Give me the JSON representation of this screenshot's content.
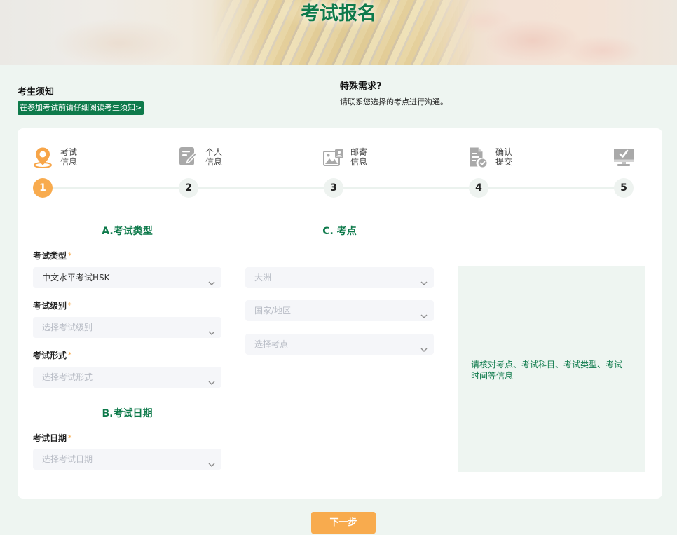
{
  "header": {
    "title": "考试报名"
  },
  "notice": {
    "candidate_title": "考生须知",
    "candidate_link": "在参加考试前请仔细阅读考生须知>",
    "special_title": "特殊需求?",
    "special_text": "请联系您选择的考点进行沟通。"
  },
  "steps": {
    "current": 1,
    "items": [
      {
        "number": "1",
        "label_lines": [
          "考试",
          "信息"
        ],
        "icon": "location-pin-icon"
      },
      {
        "number": "2",
        "label_lines": [
          "个人",
          "信息"
        ],
        "icon": "edit-document-icon"
      },
      {
        "number": "3",
        "label_lines": [
          "邮寄",
          "信息"
        ],
        "icon": "image-icon"
      },
      {
        "number": "4",
        "label_lines": [
          "确认",
          "提交"
        ],
        "icon": "document-check-icon"
      },
      {
        "number": "5",
        "icon": "monitor-check-icon"
      }
    ]
  },
  "form": {
    "required_mark": "*",
    "section_a": {
      "title": "A.考试类型",
      "fields": [
        {
          "label": "考试类型",
          "value": "中文水平考试HSK"
        },
        {
          "label": "考试级别",
          "placeholder": "选择考试级别"
        },
        {
          "label": "考试形式",
          "placeholder": "选择考试形式"
        }
      ]
    },
    "section_b": {
      "title": "B.考试日期",
      "fields": [
        {
          "label": "考试日期",
          "placeholder": "选择考试日期"
        }
      ]
    },
    "section_c": {
      "title": "C. 考点",
      "fields": [
        {
          "placeholder": "大洲"
        },
        {
          "placeholder": "国家/地区"
        },
        {
          "placeholder": "选择考点"
        }
      ]
    }
  },
  "info_panel": {
    "text": "请核对考点、考试科目、考试类型、考试时间等信息"
  },
  "footer": {
    "next_button": "下一步"
  },
  "colors": {
    "brand_green": "#0e7a4b",
    "accent_orange": "#f8ab4e",
    "page_background": "#eef5f1",
    "field_background": "#f5f6f9",
    "placeholder_text": "#b9bdc6"
  }
}
